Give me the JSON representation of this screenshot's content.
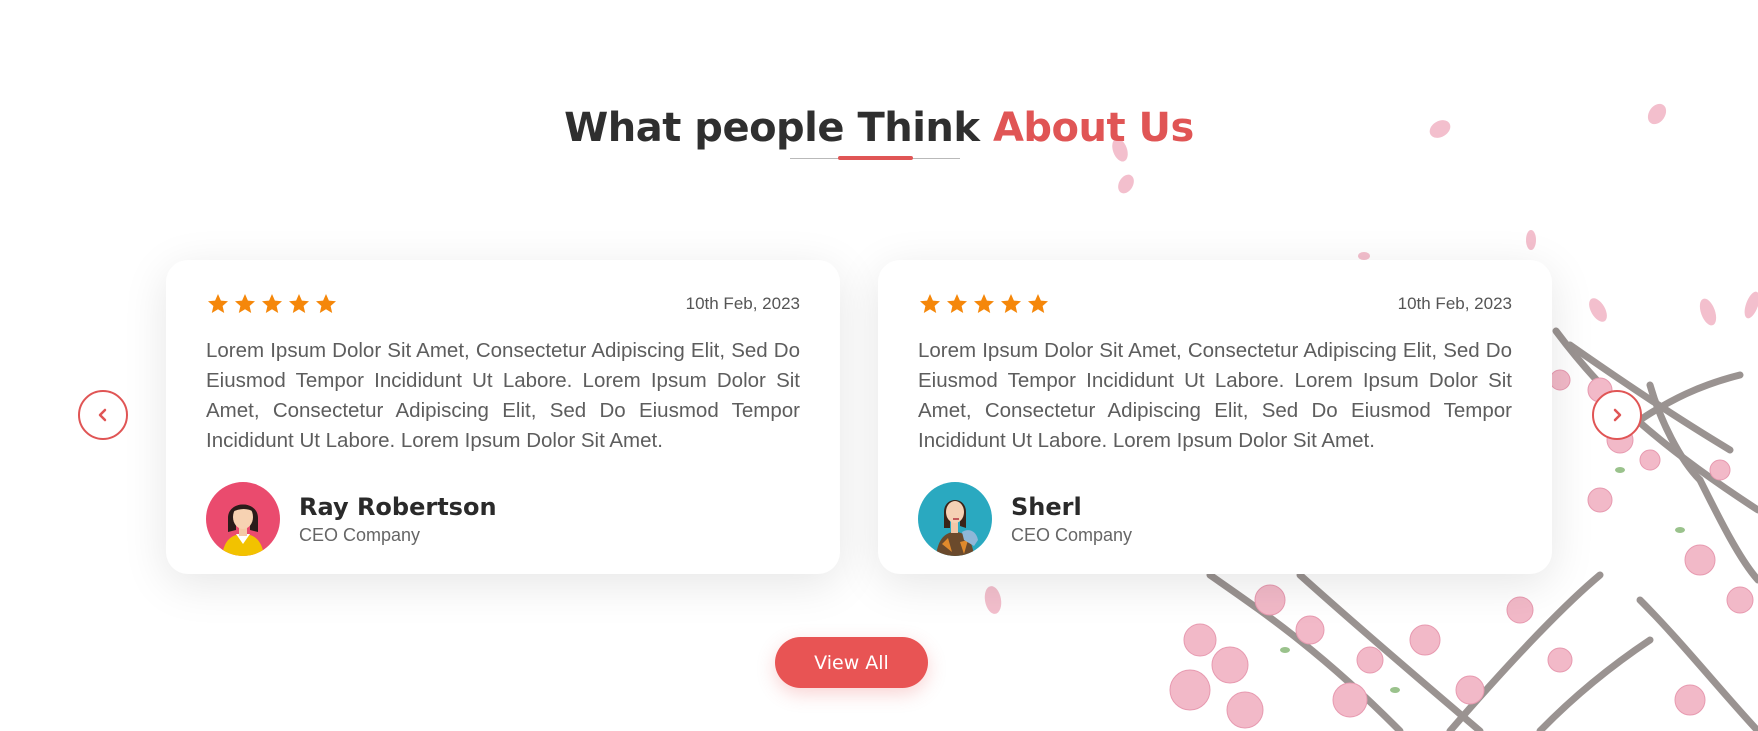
{
  "section": {
    "title_main": "What people Think ",
    "title_accent": "About Us",
    "view_all_label": "View All"
  },
  "colors": {
    "accent": "#e05555",
    "star": "#f5870a",
    "text": "#2f2f2f"
  },
  "icons": {
    "prev": "chevron-left-icon",
    "next": "chevron-right-icon",
    "rating": "star-icon"
  },
  "testimonials": [
    {
      "rating": 5,
      "date": "10th Feb, 2023",
      "text": "Lorem Ipsum Dolor Sit Amet, Consectetur Adipiscing Elit, Sed Do Eiusmod Tempor Incididunt Ut Labore. Lorem Ipsum Dolor Sit Amet, Consectetur Adipiscing Elit, Sed Do Eiusmod Tempor Incididunt Ut Labore. Lorem Ipsum Dolor Sit Amet.",
      "name": "Ray Robertson",
      "role": "CEO Company"
    },
    {
      "rating": 5,
      "date": "10th Feb, 2023",
      "text": "Lorem Ipsum Dolor Sit Amet, Consectetur Adipiscing Elit, Sed Do Eiusmod Tempor Incididunt Ut Labore. Lorem Ipsum Dolor Sit Amet, Consectetur Adipiscing Elit, Sed Do Eiusmod Tempor Incididunt Ut Labore. Lorem Ipsum Dolor Sit Amet.",
      "name": "Sherl",
      "role": "CEO Company"
    }
  ]
}
